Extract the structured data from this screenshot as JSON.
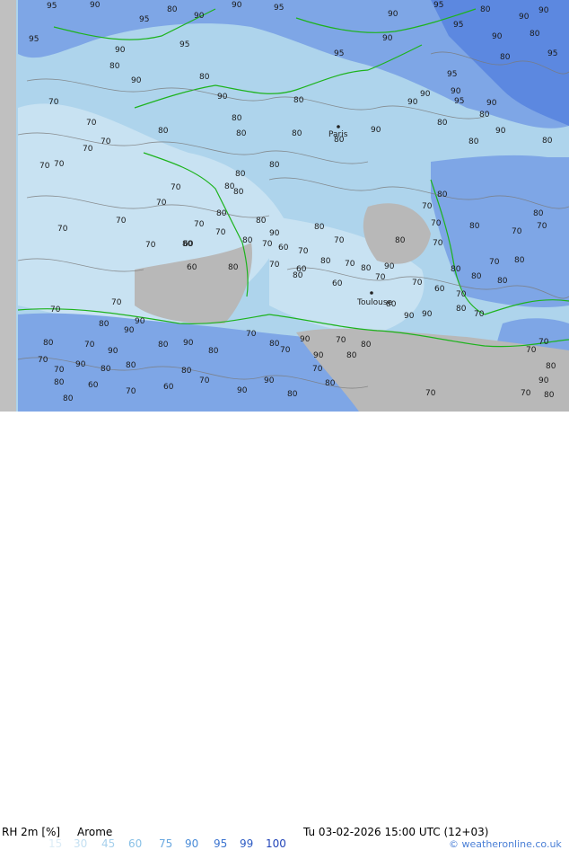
{
  "map": {
    "variable_label": "RH 2m [%]",
    "model": "Arome",
    "valid_time": "Tu 03-02-2026 15:00 UTC (12+03)",
    "credit": "© weatheronline.co.uk",
    "cities": [
      {
        "name": "Paris"
      },
      {
        "name": "Toulouse"
      }
    ],
    "contour_values": [
      "95",
      "90",
      "80",
      "90",
      "95",
      "90",
      "90",
      "95",
      "80",
      "90",
      "90",
      "95",
      "95",
      "90",
      "95",
      "95",
      "90",
      "95",
      "90",
      "80",
      "80",
      "95",
      "95",
      "90",
      "90",
      "80",
      "70",
      "80",
      "90",
      "90",
      "70",
      "80",
      "80",
      "70",
      "80",
      "80",
      "80",
      "80",
      "70",
      "80",
      "90",
      "90",
      "95",
      "90",
      "80",
      "90",
      "80",
      "80",
      "80",
      "70",
      "70",
      "80",
      "70",
      "70",
      "80",
      "70",
      "70",
      "70",
      "70",
      "60",
      "80",
      "80",
      "60",
      "80",
      "80",
      "70",
      "60",
      "70",
      "80",
      "70",
      "80",
      "70",
      "90",
      "80",
      "70",
      "80",
      "70",
      "70",
      "80",
      "60",
      "70",
      "80",
      "80",
      "70",
      "80",
      "70",
      "70",
      "80",
      "80",
      "70",
      "70",
      "70",
      "80",
      "90",
      "90",
      "80",
      "90",
      "80",
      "70",
      "80",
      "90",
      "90",
      "80",
      "70",
      "80",
      "70",
      "70",
      "80",
      "90",
      "80",
      "90",
      "70",
      "80",
      "60",
      "70",
      "60",
      "80",
      "80",
      "70",
      "70",
      "80",
      "70",
      "90",
      "80",
      "90",
      "80",
      "70",
      "70",
      "80",
      "90",
      "80",
      "70",
      "70",
      "70",
      "80",
      "90",
      "90",
      "80",
      "80",
      "70",
      "60",
      "80",
      "70",
      "60",
      "90",
      "80",
      "80",
      "70"
    ],
    "legend": {
      "values": [
        "15",
        "30",
        "45",
        "60",
        "75",
        "90",
        "95",
        "99",
        "100"
      ],
      "colors": [
        "#dcecf6",
        "#c4e0f2",
        "#a6d0ec",
        "#88c0e6",
        "#6aa8e0",
        "#4a8cd8",
        "#3c74d0",
        "#2e5cc4",
        "#2244b8"
      ]
    },
    "colors": {
      "land_base": "#aed4ec",
      "land_low": "#c8e2f2",
      "high": "#7ea6e6",
      "very_high": "#5c88e0",
      "sea_gray": "#b8b8b8",
      "left_strip": "#c0c0c0",
      "coast": "#1db31d",
      "contour": "#7a7a7a"
    }
  }
}
